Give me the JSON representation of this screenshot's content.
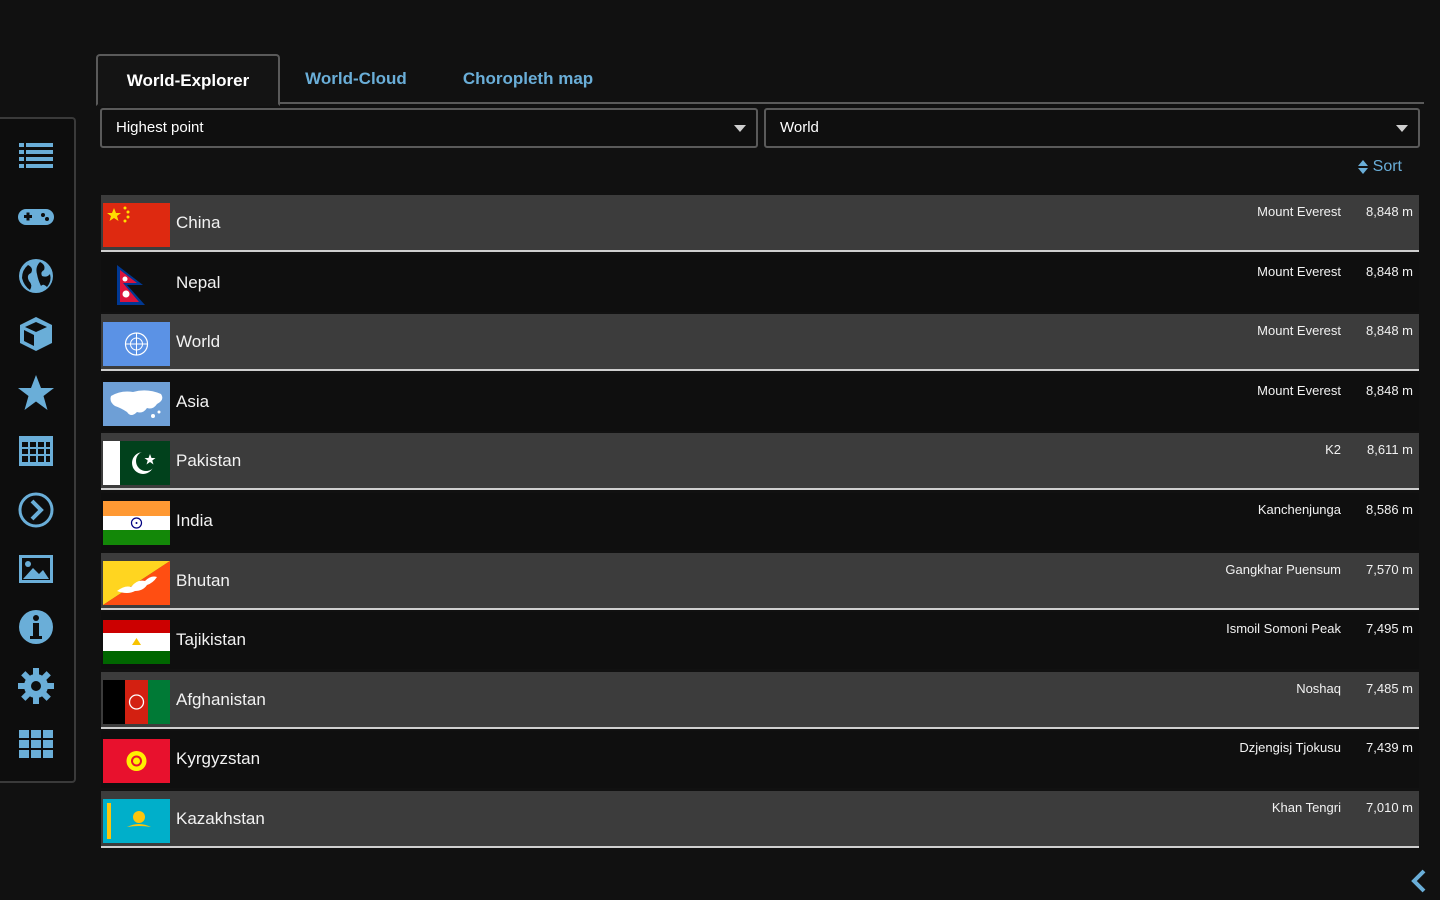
{
  "tabs": [
    {
      "label": "World-Explorer",
      "active": true
    },
    {
      "label": "World-Cloud",
      "active": false
    },
    {
      "label": "Choropleth map",
      "active": false
    }
  ],
  "filters": {
    "attribute": "Highest point",
    "region": "World"
  },
  "sort_label": "Sort",
  "sidebar": {
    "icons": [
      "list-icon",
      "gamepad-icon",
      "globe-icon",
      "cube-icon",
      "star-icon",
      "table-icon",
      "chevron-circle-icon",
      "image-icon",
      "info-icon",
      "gear-icon",
      "apps-grid-icon"
    ]
  },
  "rows": [
    {
      "name": "China",
      "peak": "Mount Everest",
      "height": "8,848 m",
      "flag": "china"
    },
    {
      "name": "Nepal",
      "peak": "Mount Everest",
      "height": "8,848 m",
      "flag": "nepal"
    },
    {
      "name": "World",
      "peak": "Mount Everest",
      "height": "8,848 m",
      "flag": "world"
    },
    {
      "name": "Asia",
      "peak": "Mount Everest",
      "height": "8,848 m",
      "flag": "asia"
    },
    {
      "name": "Pakistan",
      "peak": "K2",
      "height": "8,611 m",
      "flag": "pakistan"
    },
    {
      "name": "India",
      "peak": "Kanchenjunga",
      "height": "8,586 m",
      "flag": "india"
    },
    {
      "name": "Bhutan",
      "peak": "Gangkhar Puensum",
      "height": "7,570 m",
      "flag": "bhutan"
    },
    {
      "name": "Tajikistan",
      "peak": "Ismoil Somoni Peak",
      "height": "7,495 m",
      "flag": "tajikistan"
    },
    {
      "name": "Afghanistan",
      "peak": "Noshaq",
      "height": "7,485 m",
      "flag": "afghanistan"
    },
    {
      "name": "Kyrgyzstan",
      "peak": "Dzjengisj Tjokusu",
      "height": "7,439 m",
      "flag": "kyrgyzstan"
    },
    {
      "name": "Kazakhstan",
      "peak": "Khan Tengri",
      "height": "7,010 m",
      "flag": "kazakhstan"
    }
  ],
  "colors": {
    "accent": "#6aaed8",
    "sidebar_icon": "#6aaed8",
    "row_alt": "#3c3c3c",
    "background": "#111111"
  }
}
